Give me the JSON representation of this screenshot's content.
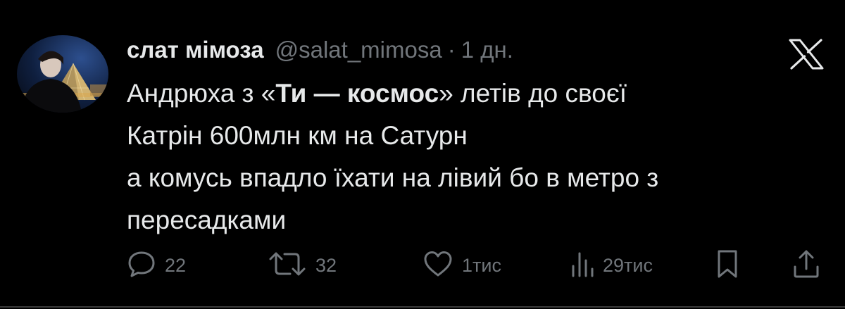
{
  "tweet": {
    "author": {
      "display_name": "слат мімоза",
      "handle": "@salat_mimosa",
      "separator": "·",
      "time": "1 дн."
    },
    "text": {
      "line1_before": "Андрюха з «",
      "line1_bold": "Ти — космос",
      "line1_after": "» летів до своєї",
      "line2": "Катрін 600млн км на Сатурн",
      "line3": "а комусь впадло їхати на лівий бо в метро з",
      "line4": "пересадками"
    },
    "actions": {
      "replies": "22",
      "reposts": "32",
      "likes": "1тис",
      "views": "29тис"
    }
  },
  "icons": {
    "close": "x-logo-icon",
    "reply": "speech-bubble-icon",
    "repost": "repost-arrows-icon",
    "like": "heart-icon",
    "views": "bar-chart-icon",
    "bookmark": "bookmark-icon",
    "share": "share-icon"
  },
  "colors": {
    "background": "#000000",
    "text": "#e7e9ea",
    "muted": "#71767b"
  }
}
